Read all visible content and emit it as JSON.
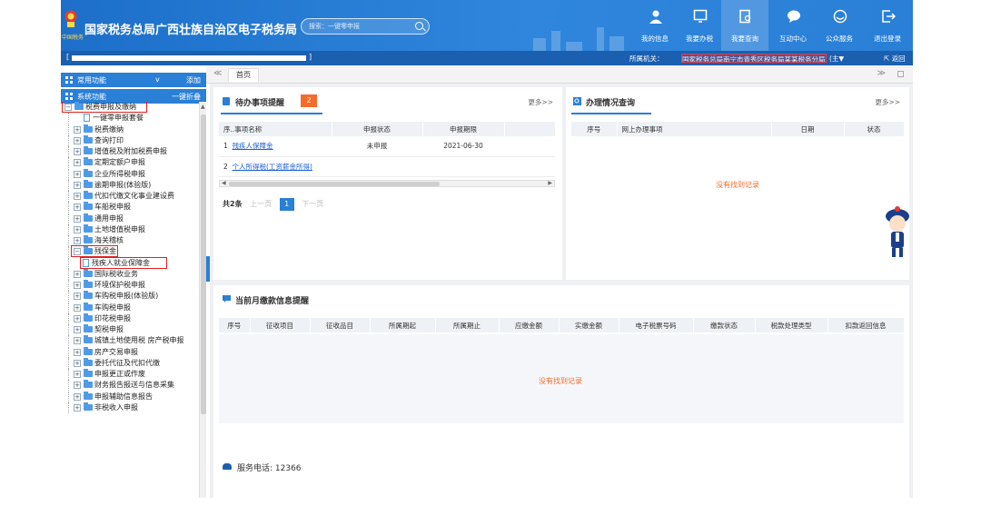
{
  "header": {
    "emblem_caption": "中国税务",
    "title": "国家税务总局广西壮族自治区电子税务局",
    "search_placeholder": "搜索：一键零申报",
    "nav": [
      {
        "label": "我的信息",
        "icon": "user-icon"
      },
      {
        "label": "我要办税",
        "icon": "monitor-icon"
      },
      {
        "label": "我要查询",
        "icon": "search-doc-icon"
      },
      {
        "label": "互动中心",
        "icon": "chat-icon"
      },
      {
        "label": "公众服务",
        "icon": "service-icon"
      },
      {
        "label": "退出登录",
        "icon": "logout-icon"
      }
    ]
  },
  "subbar": {
    "bracket_left": "[",
    "bracket_right": "]",
    "org_label": "所属机关：",
    "org_value": "国家税务总局南宁市青秀区税务局某某税务分局",
    "org_suffix": "(主▼",
    "back_label": "返回"
  },
  "sidebar": {
    "common_label": "常用功能",
    "common_toggle": "v",
    "common_add": "添加",
    "system_label": "系统功能",
    "system_collapse": "一键折叠",
    "tree": [
      {
        "label": "税费申报及缴纳",
        "type": "folder",
        "level": 0,
        "expanded": true,
        "highlight": true
      },
      {
        "label": "一键零申报套餐",
        "type": "doc",
        "level": 1
      },
      {
        "label": "税费缴纳",
        "type": "folder",
        "level": 1
      },
      {
        "label": "查询打印",
        "type": "folder",
        "level": 1
      },
      {
        "label": "增值税及附加税费申报",
        "type": "folder",
        "level": 1
      },
      {
        "label": "定期定额户申报",
        "type": "folder",
        "level": 1
      },
      {
        "label": "企业所得税申报",
        "type": "folder",
        "level": 1
      },
      {
        "label": "逾期申报(体验版)",
        "type": "folder",
        "level": 1
      },
      {
        "label": "代扣代缴文化事业建设费",
        "type": "folder",
        "level": 1
      },
      {
        "label": "车船税申报",
        "type": "folder",
        "level": 1
      },
      {
        "label": "通用申报",
        "type": "folder",
        "level": 1
      },
      {
        "label": "土地增值税申报",
        "type": "folder",
        "level": 1
      },
      {
        "label": "海关稽核",
        "type": "folder",
        "level": 1
      },
      {
        "label": "残保金",
        "type": "folder",
        "level": 1,
        "expanded": true,
        "highlight": true
      },
      {
        "label": "残疾人就业保障金",
        "type": "doc",
        "level": 2,
        "highlight": true
      },
      {
        "label": "国际税收业务",
        "type": "folder",
        "level": 1
      },
      {
        "label": "环境保护税申报",
        "type": "folder",
        "level": 1
      },
      {
        "label": "车购税申报(体验版)",
        "type": "folder",
        "level": 1
      },
      {
        "label": "车购税申报",
        "type": "folder",
        "level": 1
      },
      {
        "label": "印花税申报",
        "type": "folder",
        "level": 1
      },
      {
        "label": "契税申报",
        "type": "folder",
        "level": 1
      },
      {
        "label": "城镇土地使用税 房产税申报",
        "type": "folder",
        "level": 1
      },
      {
        "label": "房产交易申报",
        "type": "folder",
        "level": 1
      },
      {
        "label": "委托代征及代扣代缴",
        "type": "folder",
        "level": 1
      },
      {
        "label": "申报更正或作废",
        "type": "folder",
        "level": 1
      },
      {
        "label": "财务报告报送与信息采集",
        "type": "folder",
        "level": 1
      },
      {
        "label": "申报辅助信息报告",
        "type": "folder",
        "level": 1
      },
      {
        "label": "非税收入申报",
        "type": "folder",
        "level": 1
      }
    ]
  },
  "tabs": {
    "left_arrow": "≪",
    "home": "首页",
    "right_arrow": "≫"
  },
  "todo": {
    "title": "待办事项提醒",
    "count": "2",
    "more": "更多>>",
    "columns": [
      "序..",
      "事项名称",
      "申报状态",
      "申报期限"
    ],
    "rows": [
      {
        "no": "1",
        "name": "残疾人保障金",
        "status": "未申报",
        "deadline": "2021-06-30"
      },
      {
        "no": "2",
        "name": "个人所得税(工资薪金所得)",
        "status": "",
        "deadline": ""
      }
    ],
    "pager": {
      "total": "共2条",
      "prev": "上一页",
      "current": "1",
      "next": "下一页"
    }
  },
  "query": {
    "title": "办理情况查询",
    "more": "更多>>",
    "columns": [
      "序号",
      "网上办理事项",
      "日期",
      "状态"
    ],
    "empty": "没有找到记录"
  },
  "payment": {
    "title": "当前月缴款信息提醒",
    "columns": [
      "序号",
      "征收项目",
      "征收品目",
      "所属期起",
      "所属期止",
      "应缴金额",
      "实缴金额",
      "电子税票号码",
      "缴款状态",
      "税款处理类型",
      "扣款返回信息"
    ],
    "empty": "没有找到记录"
  },
  "service": {
    "label": "服务电话: ",
    "phone": "12366"
  },
  "colors": {
    "header_blue": "#2a7fd6",
    "subbar_blue": "#1a5fb0",
    "badge_orange": "#f56b2a",
    "highlight_red": "#e02020"
  }
}
